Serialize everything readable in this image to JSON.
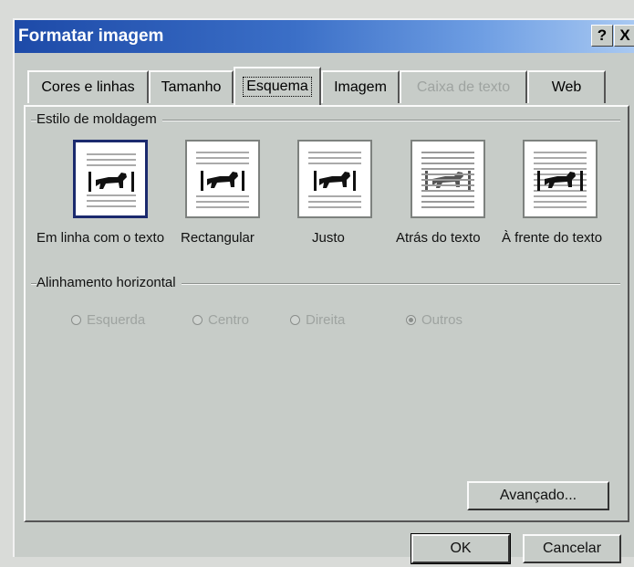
{
  "window": {
    "title": "Formatar imagem",
    "help_glyph": "?",
    "close_glyph": "X"
  },
  "tabs": [
    {
      "label": "Cores e linhas",
      "state": "normal"
    },
    {
      "label": "Tamanho",
      "state": "normal"
    },
    {
      "label": "Esquema",
      "state": "active"
    },
    {
      "label": "Imagem",
      "state": "normal"
    },
    {
      "label": "Caixa de texto",
      "state": "disabled"
    },
    {
      "label": "Web",
      "state": "normal"
    }
  ],
  "wrap_group": {
    "title": "Estilo de moldagem",
    "options": [
      {
        "label": "Em linha com o texto",
        "icon": "inline-wrap-icon",
        "selected": true
      },
      {
        "label": "Rectangular",
        "icon": "square-wrap-icon",
        "selected": false
      },
      {
        "label": "Justo",
        "icon": "tight-wrap-icon",
        "selected": false
      },
      {
        "label": "Atrás do texto",
        "icon": "behind-text-icon",
        "selected": false
      },
      {
        "label": "À frente do texto",
        "icon": "in-front-of-text-icon",
        "selected": false
      }
    ]
  },
  "align_group": {
    "title": "Alinhamento horizontal",
    "options": [
      {
        "label": "Esquerda",
        "checked": false
      },
      {
        "label": "Centro",
        "checked": false
      },
      {
        "label": "Direita",
        "checked": false
      },
      {
        "label": "Outros",
        "checked": true
      }
    ],
    "enabled": false
  },
  "buttons": {
    "advanced": "Avançado...",
    "ok": "OK",
    "cancel": "Cancelar"
  },
  "colors": {
    "title_bar_start": "#1d4aa8",
    "title_bar_end": "#a9c9f2",
    "dialog_face": "#c7ccc8",
    "selection_border": "#1b2a6e"
  }
}
